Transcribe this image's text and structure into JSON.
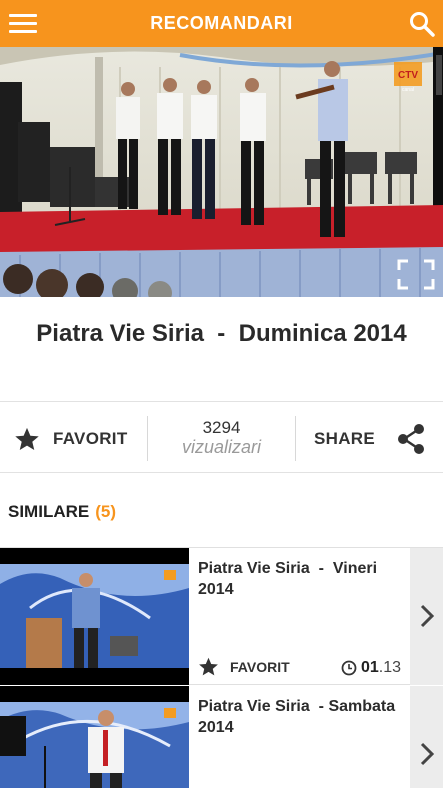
{
  "header": {
    "title": "RECOMANDARI",
    "menu_icon": "hamburger-menu-icon",
    "search_icon": "search-icon"
  },
  "hero": {
    "logo_text": "CTV",
    "logo_subtext": "canal",
    "fullscreen_icon": "fullscreen-icon"
  },
  "video": {
    "title": "Piatra Vie Siria  -  Duminica 2014"
  },
  "actions": {
    "favorite_label": "FAVORIT",
    "views_count": "3294",
    "views_label": "vizualizari",
    "share_label": "SHARE"
  },
  "similar": {
    "heading": "SIMILARE",
    "count": "(5)",
    "items": [
      {
        "title": "Piatra Vie Siria  -  Vineri 2014",
        "favorite_label": "FAVORIT",
        "duration_bold": "01",
        "duration_rest": ".13"
      },
      {
        "title": "Piatra Vie Siria  - Sambata 2014"
      }
    ]
  },
  "colors": {
    "accent": "#f7941d",
    "text": "#2a2a2a",
    "muted": "#9a9a9a"
  }
}
